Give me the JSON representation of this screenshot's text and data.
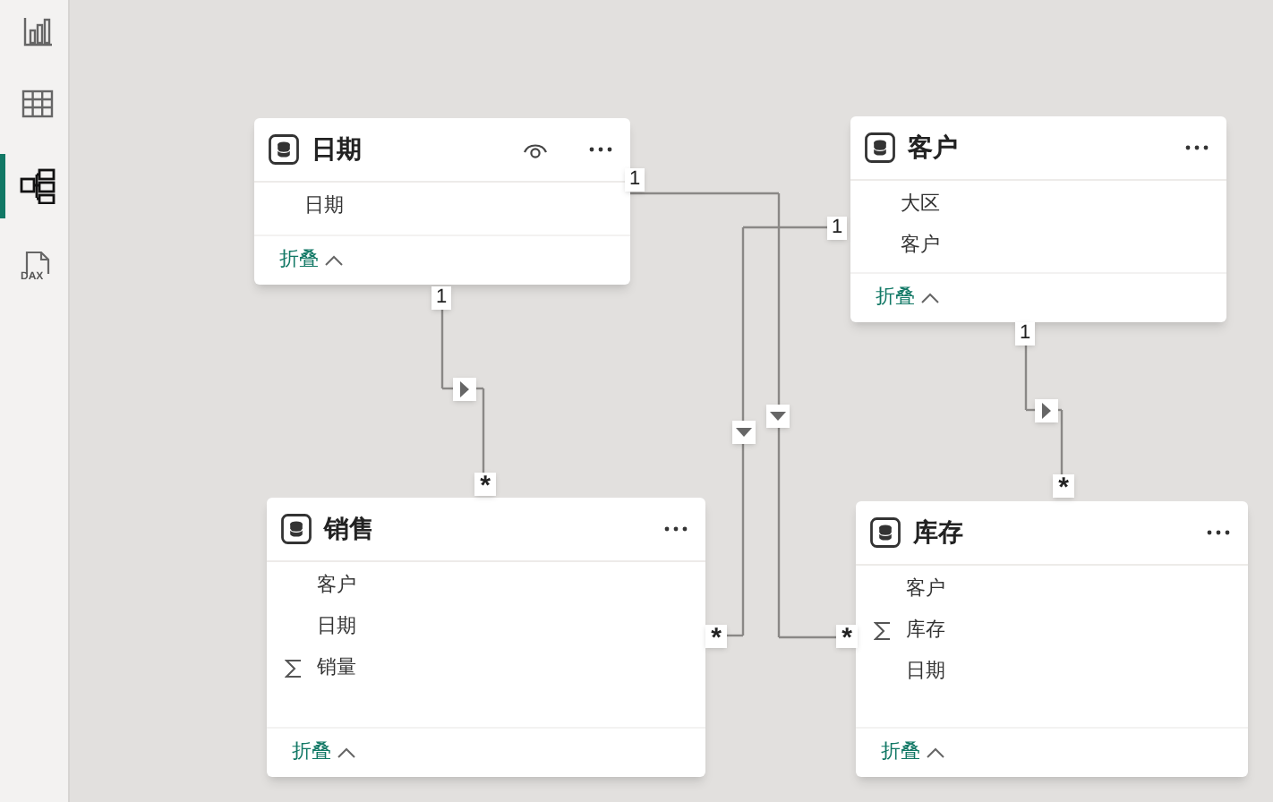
{
  "sidebar": {
    "items": [
      {
        "kind": "report",
        "selected": false
      },
      {
        "kind": "data",
        "selected": false
      },
      {
        "kind": "model",
        "selected": true
      },
      {
        "kind": "dax",
        "selected": false,
        "icon_text": "DAX"
      }
    ]
  },
  "tables": [
    {
      "name": "日期",
      "view_icon": true,
      "fields": [
        {
          "name": "日期",
          "kind": "column"
        }
      ],
      "collapse": "折叠"
    },
    {
      "name": "客户",
      "view_icon": false,
      "fields": [
        {
          "name": "大区",
          "kind": "column"
        },
        {
          "name": "客户",
          "kind": "column"
        }
      ],
      "collapse": "折叠"
    },
    {
      "name": "销售",
      "view_icon": false,
      "fields": [
        {
          "name": "客户",
          "kind": "column"
        },
        {
          "name": "日期",
          "kind": "column"
        },
        {
          "name": "销量",
          "kind": "measure"
        }
      ],
      "collapse": "折叠"
    },
    {
      "name": "库存",
      "view_icon": false,
      "fields": [
        {
          "name": "客户",
          "kind": "column"
        },
        {
          "name": "库存",
          "kind": "measure"
        },
        {
          "name": "日期",
          "kind": "column"
        }
      ],
      "collapse": "折叠"
    }
  ],
  "relationships": [
    {
      "from_label": "1",
      "to_label": "*"
    },
    {
      "from_label": "1",
      "to_label": "*"
    },
    {
      "from_label": "1",
      "to_label": "*"
    },
    {
      "from_label": "1",
      "to_label": "*"
    }
  ]
}
